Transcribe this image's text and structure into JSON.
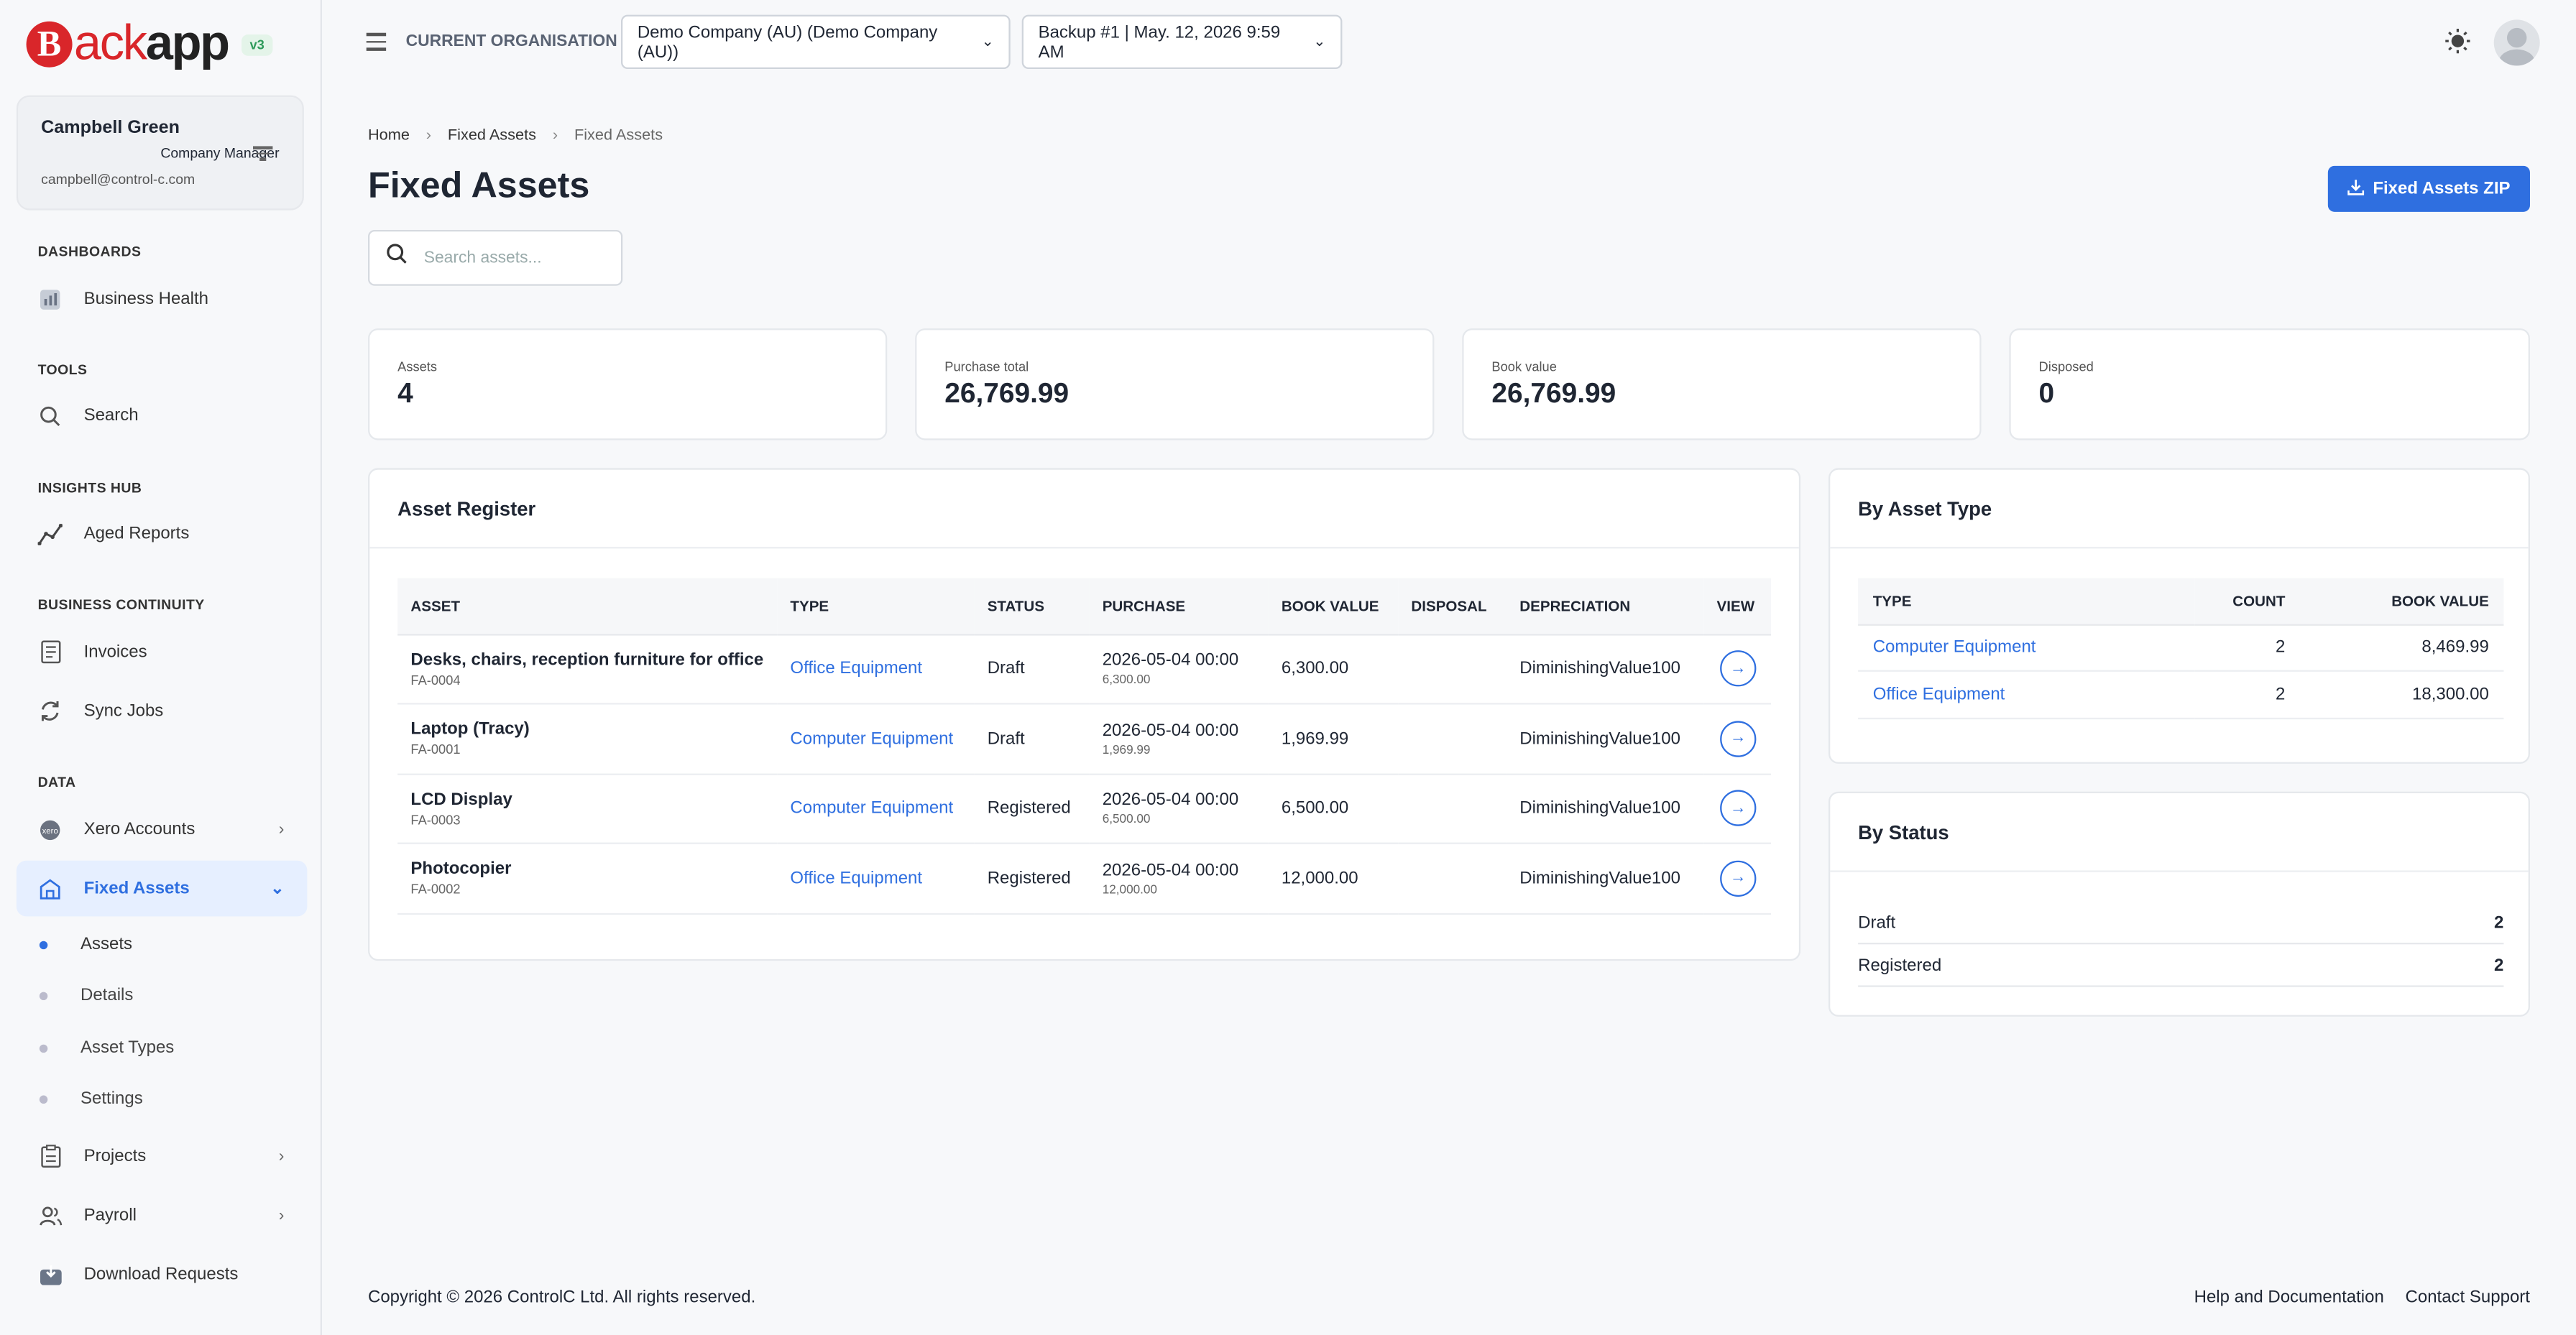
{
  "brand": {
    "logo_letter": "B",
    "logo_mid": "ack",
    "logo_end": "app",
    "version": "v3"
  },
  "user": {
    "name": "Campbell Green",
    "role": "Company Manager",
    "email": "campbell@control-c.com"
  },
  "sidebar": {
    "sections": {
      "dashboards": "DASHBOARDS",
      "tools": "TOOLS",
      "insights": "INSIGHTS HUB",
      "continuity": "BUSINESS CONTINUITY",
      "data": "DATA"
    },
    "items": {
      "business_health": "Business Health",
      "search": "Search",
      "aged_reports": "Aged Reports",
      "invoices": "Invoices",
      "sync_jobs": "Sync Jobs",
      "xero_accounts": "Xero Accounts",
      "fixed_assets": "Fixed Assets",
      "projects": "Projects",
      "payroll": "Payroll",
      "download_requests": "Download Requests"
    },
    "sub_items": {
      "assets": "Assets",
      "details": "Details",
      "asset_types": "Asset Types",
      "settings": "Settings"
    }
  },
  "topbar": {
    "org_label": "CURRENT ORGANISATION",
    "org_value": "Demo Company (AU) (Demo Company (AU))",
    "backup_value": "Backup #1 | May. 12, 2026 9:59 AM"
  },
  "breadcrumb": {
    "home": "Home",
    "section": "Fixed Assets",
    "current": "Fixed Assets"
  },
  "page": {
    "title": "Fixed Assets",
    "zip_button": "Fixed Assets ZIP",
    "search_placeholder": "Search assets..."
  },
  "kpis": {
    "assets": {
      "label": "Assets",
      "value": "4"
    },
    "purchase": {
      "label": "Purchase total",
      "value": "26,769.99"
    },
    "book": {
      "label": "Book value",
      "value": "26,769.99"
    },
    "disposed": {
      "label": "Disposed",
      "value": "0"
    }
  },
  "register": {
    "title": "Asset Register",
    "columns": {
      "asset": "ASSET",
      "type": "TYPE",
      "status": "STATUS",
      "purchase": "PURCHASE",
      "book": "BOOK VALUE",
      "disposal": "DISPOSAL",
      "depreciation": "DEPRECIATION",
      "view": "VIEW"
    },
    "rows": [
      {
        "name": "Desks, chairs, reception furniture for office",
        "code": "FA-0004",
        "type": "Office Equipment",
        "status": "Draft",
        "purchase_date": "2026-05-04 00:00",
        "purchase_amount": "6,300.00",
        "book": "6,300.00",
        "disposal": "",
        "depreciation": "DiminishingValue100"
      },
      {
        "name": "Laptop (Tracy)",
        "code": "FA-0001",
        "type": "Computer Equipment",
        "status": "Draft",
        "purchase_date": "2026-05-04 00:00",
        "purchase_amount": "1,969.99",
        "book": "1,969.99",
        "disposal": "",
        "depreciation": "DiminishingValue100"
      },
      {
        "name": "LCD Display",
        "code": "FA-0003",
        "type": "Computer Equipment",
        "status": "Registered",
        "purchase_date": "2026-05-04 00:00",
        "purchase_amount": "6,500.00",
        "book": "6,500.00",
        "disposal": "",
        "depreciation": "DiminishingValue100"
      },
      {
        "name": "Photocopier",
        "code": "FA-0002",
        "type": "Office Equipment",
        "status": "Registered",
        "purchase_date": "2026-05-04 00:00",
        "purchase_amount": "12,000.00",
        "book": "12,000.00",
        "disposal": "",
        "depreciation": "DiminishingValue100"
      }
    ]
  },
  "by_type": {
    "title": "By Asset Type",
    "columns": {
      "type": "TYPE",
      "count": "COUNT",
      "book": "BOOK VALUE"
    },
    "rows": [
      {
        "type": "Computer Equipment",
        "count": "2",
        "book": "8,469.99"
      },
      {
        "type": "Office Equipment",
        "count": "2",
        "book": "18,300.00"
      }
    ]
  },
  "by_status": {
    "title": "By Status",
    "rows": [
      {
        "label": "Draft",
        "count": "2"
      },
      {
        "label": "Registered",
        "count": "2"
      }
    ]
  },
  "footer": {
    "copyright": "Copyright © 2026 ControlC Ltd. All rights reserved.",
    "help": "Help and Documentation",
    "support": "Contact Support"
  },
  "colors": {
    "accent": "#2f6fe0",
    "brand_red": "#d9262a"
  }
}
